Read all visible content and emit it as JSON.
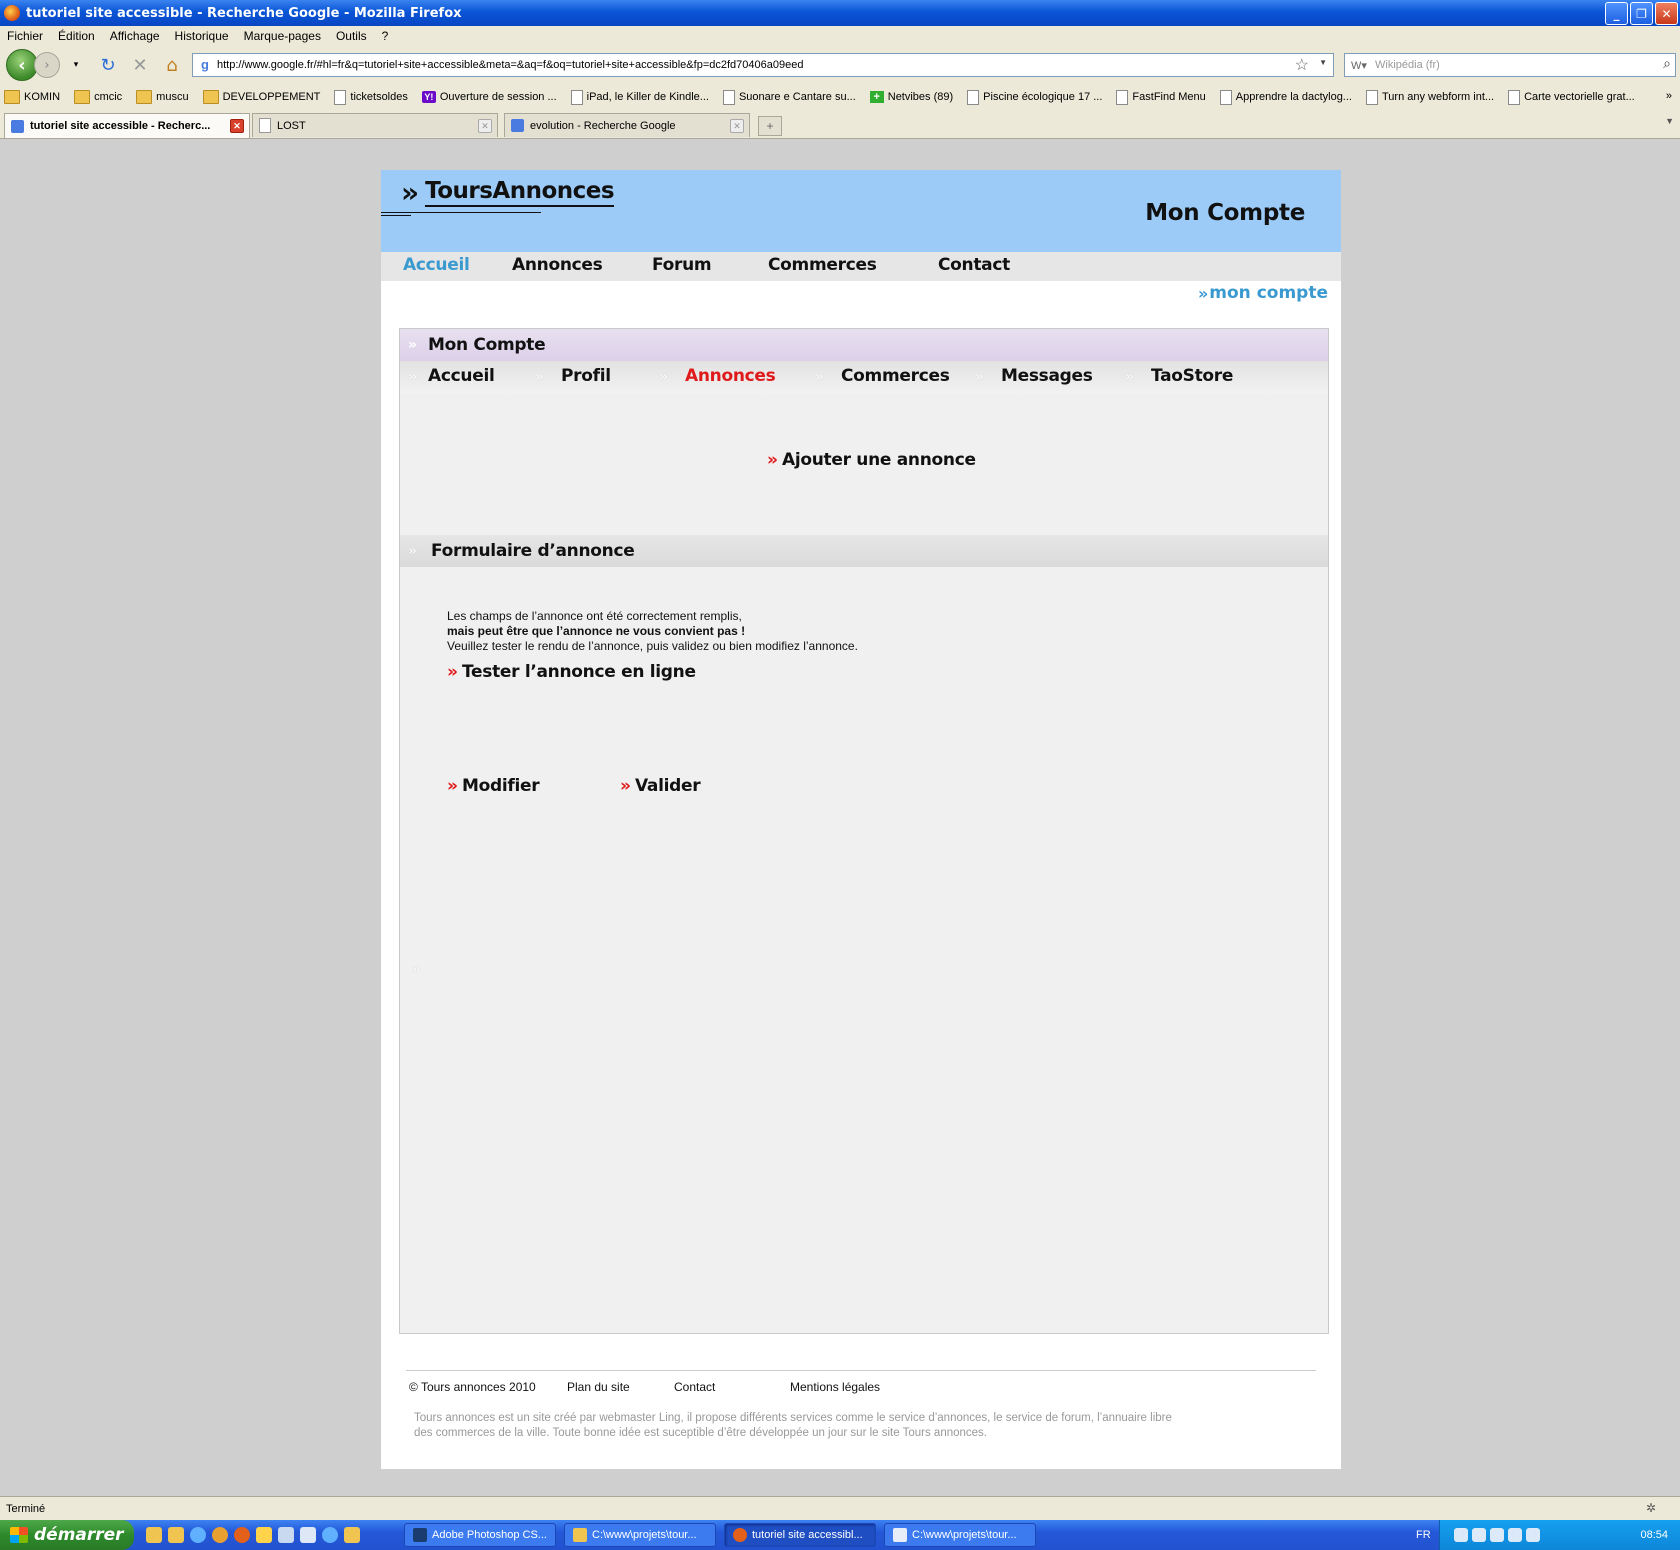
{
  "window": {
    "title": "tutoriel site accessible - Recherche Google - Mozilla Firefox"
  },
  "menu": [
    "Fichier",
    "Édition",
    "Affichage",
    "Historique",
    "Marque-pages",
    "Outils",
    "?"
  ],
  "navbar": {
    "url": "http://www.google.fr/#hl=fr&q=tutoriel+site+accessible&meta=&aq=f&oq=tutoriel+site+accessible&fp=dc2fd70406a09eed",
    "search_placeholder": "Wikipédia (fr)"
  },
  "bookmarks": [
    {
      "label": "KOMIN",
      "icon": "folder"
    },
    {
      "label": "cmcic",
      "icon": "folder"
    },
    {
      "label": "muscu",
      "icon": "folder"
    },
    {
      "label": "DEVELOPPEMENT",
      "icon": "folder"
    },
    {
      "label": "ticketsoldes",
      "icon": "page"
    },
    {
      "label": "Ouverture de session ...",
      "icon": "yahoo"
    },
    {
      "label": "iPad, le Killer de Kindle...",
      "icon": "page"
    },
    {
      "label": "Suonare e Cantare su...",
      "icon": "page"
    },
    {
      "label": "Netvibes (89)",
      "icon": "plus"
    },
    {
      "label": "Piscine écologique 17 ...",
      "icon": "page"
    },
    {
      "label": "FastFind Menu",
      "icon": "page"
    },
    {
      "label": "Apprendre la dactylog...",
      "icon": "page"
    },
    {
      "label": "Turn any webform int...",
      "icon": "page"
    },
    {
      "label": "Carte vectorielle grat...",
      "icon": "page"
    }
  ],
  "bookmarks_more": "»",
  "tabs": [
    {
      "label": "tutoriel site accessible - Recherc...",
      "active": true
    },
    {
      "label": "LOST",
      "active": false
    },
    {
      "label": "evolution - Recherche Google",
      "active": false
    }
  ],
  "site": {
    "logo": "ToursAnnonces",
    "logo_chevron": "»",
    "banner_title": "Mon Compte",
    "nav": [
      "Accueil",
      "Annonces",
      "Forum",
      "Commerces",
      "Contact"
    ],
    "breadcrumb": "mon compte",
    "panel_title": "Mon Compte",
    "subnav": [
      "Accueil",
      "Profil",
      "Annonces",
      "Commerces",
      "Messages",
      "TaoStore"
    ],
    "add_link": "Ajouter une annonce",
    "form_title": "Formulaire d’annonce",
    "message": {
      "line1": "Les champs de l’annonce ont été correctement remplis,",
      "line2": "mais peut être que l’annonce ne vous convient pas !",
      "line3": "Veuillez tester le rendu de l’annonce, puis validez ou bien modifiez l’annonce."
    },
    "test_link": "Tester l’annonce en ligne",
    "modify_button": "Modifier",
    "validate_button": "Valider",
    "footer": {
      "copyright": "© Tours annonces 2010",
      "sitemap": "Plan du site",
      "contact": "Contact",
      "legal": "Mentions légales",
      "text": "Tours annonces est un site créé par webmaster Ling, il propose différents services comme le service d’annonces, le service de forum, l’annuaire libre des commerces de la ville. Toute bonne idée est suceptible d’être développée un jour sur le site Tours annonces."
    },
    "accent_blue": "#3a9ad0",
    "accent_red": "#e01a1a",
    "banner_color": "#9dcbf8"
  },
  "status": "Terminé",
  "taskbar": {
    "start": "démarrer",
    "items": [
      "Adobe Photoshop CS...",
      "C:\\www\\projets\\tour...",
      "tutoriel site accessibl...",
      "C:\\www\\projets\\tour..."
    ],
    "lang": "FR",
    "clock": "08:54"
  }
}
